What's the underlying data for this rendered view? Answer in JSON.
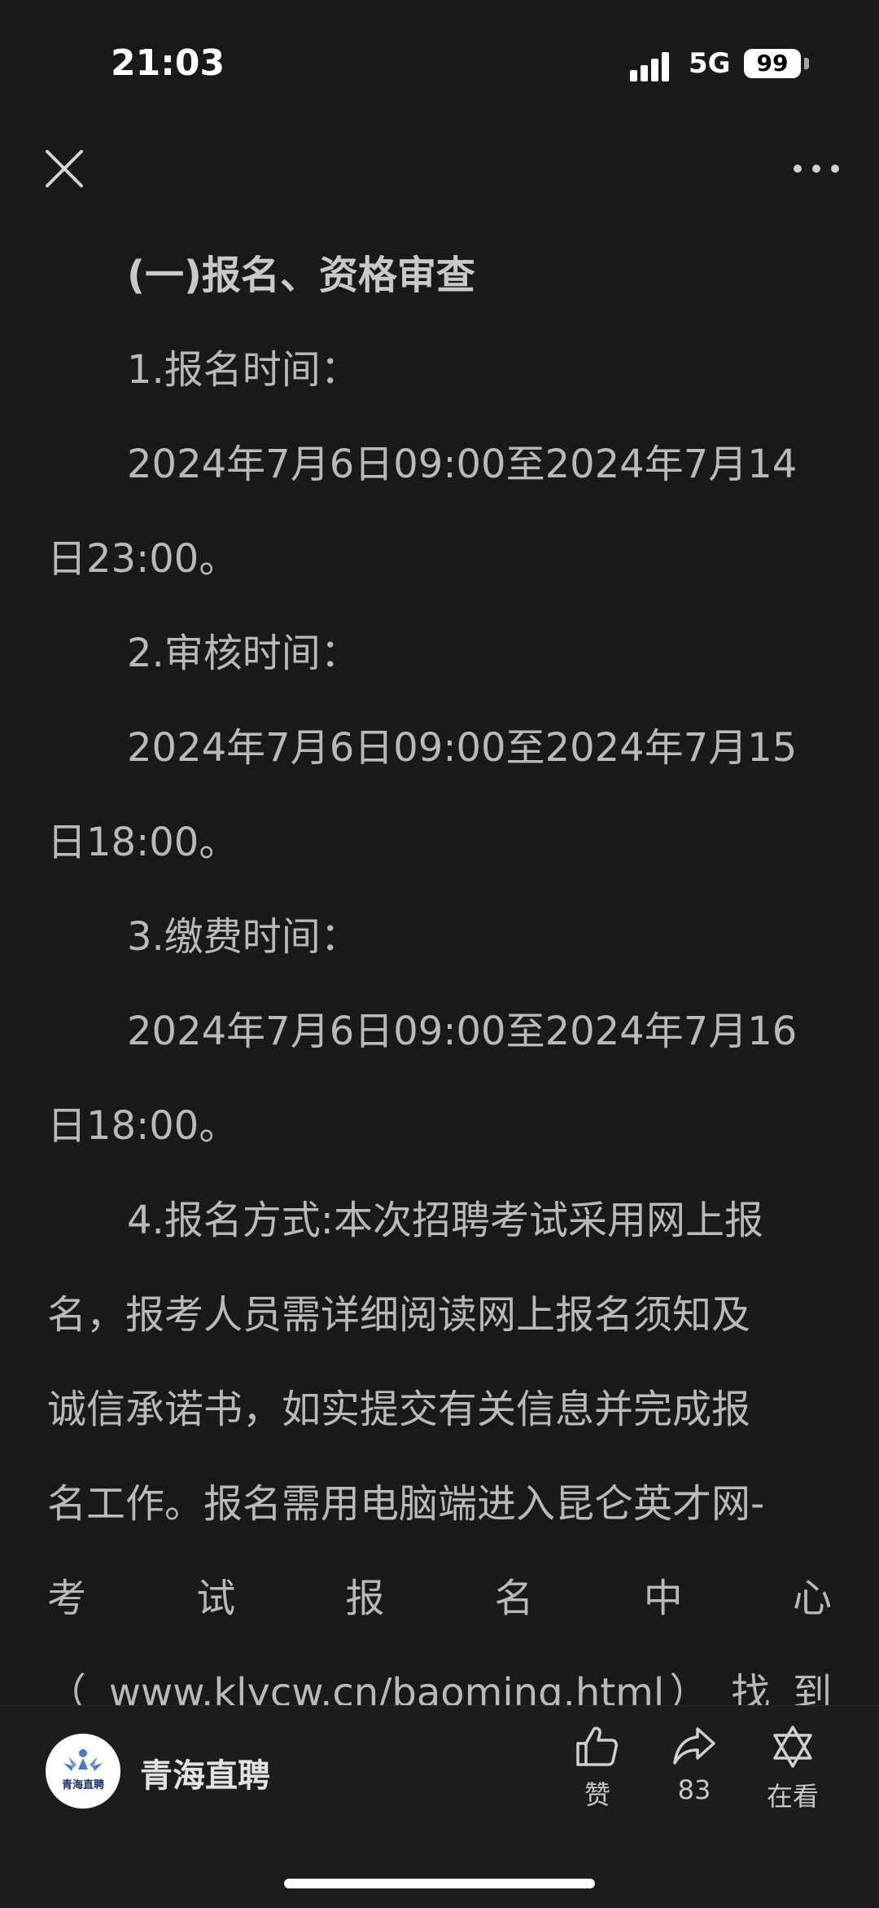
{
  "status": {
    "time": "21:03",
    "network": "5G",
    "battery": "99"
  },
  "nav": {
    "close_icon": "close-icon",
    "more_icon": "more-icon"
  },
  "article": {
    "heading": "(一)报名、资格审查",
    "item1_title": "1.报名时间：",
    "item1_line1": "2024年7月6日09:00至2024年7月14",
    "item1_line2": "日23:00。",
    "item2_title": "2.审核时间：",
    "item2_line1": "2024年7月6日09:00至2024年7月15",
    "item2_line2": "日18:00。",
    "item3_title": "3.缴费时间：",
    "item3_line1": "2024年7月6日09:00至2024年7月16",
    "item3_line2": "日18:00。",
    "item4_line1": "4.报名方式:本次招聘考试采用网上报",
    "item4_line2": "名，报考人员需详细阅读网上报名须知及",
    "item4_line3": "诚信承诺书，如实提交有关信息并完成报",
    "item4_line4": "名工作。报名需用电脑端进入昆仑英才网-",
    "item4_line5": "考 试 报 名 中 心",
    "item4_line6": "（ www.klycw.cn/baoming.html） 找 到"
  },
  "bottom": {
    "account_name": "青海直聘",
    "avatar_text": "青海直聘",
    "like_label": "赞",
    "share_count": "83",
    "watching_label": "在看"
  }
}
